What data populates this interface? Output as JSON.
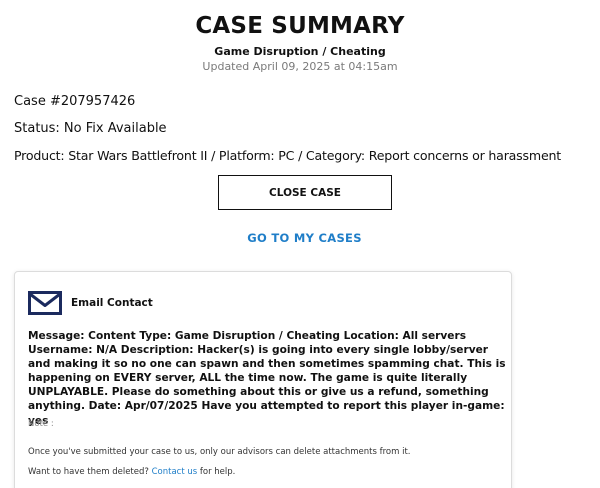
{
  "header": {
    "title": "CASE SUMMARY",
    "subtitle": "Game Disruption / Cheating",
    "updated": "Updated April 09, 2025 at 04:15am"
  },
  "case": {
    "number": "Case #207957426",
    "status": "Status: No Fix Available",
    "product": "Product: Star Wars Battlefront II / Platform: PC / Category: Report concerns or harassment"
  },
  "actions": {
    "close_label": "CLOSE CASE",
    "my_cases_label": "GO TO MY CASES"
  },
  "email": {
    "icon": "mail-icon",
    "title": "Email Contact",
    "message": "Message: Content Type: Game Disruption / Cheating Location: All servers Username: N/A Description: Hacker(s) is going into every single lobby/server and making it so no one can spawn and then sometimes spamming chat. This is happening on EVERY server, ALL the time now. The game is quite literally UNPLAYABLE. Please do something about this or give us a refund, something anything. Date: Apr/07/2025 Have you attempted to report this player in-game: yes",
    "note": "Note :",
    "attachments_text": "Once you've submitted your case to us, only our advisors can delete attachments from it.",
    "delete_prefix": "Want to have them deleted?",
    "contact_link": "Contact us",
    "delete_suffix": "for help."
  },
  "colors": {
    "link": "#1f7ec8",
    "icon": "#1b2a5e"
  }
}
